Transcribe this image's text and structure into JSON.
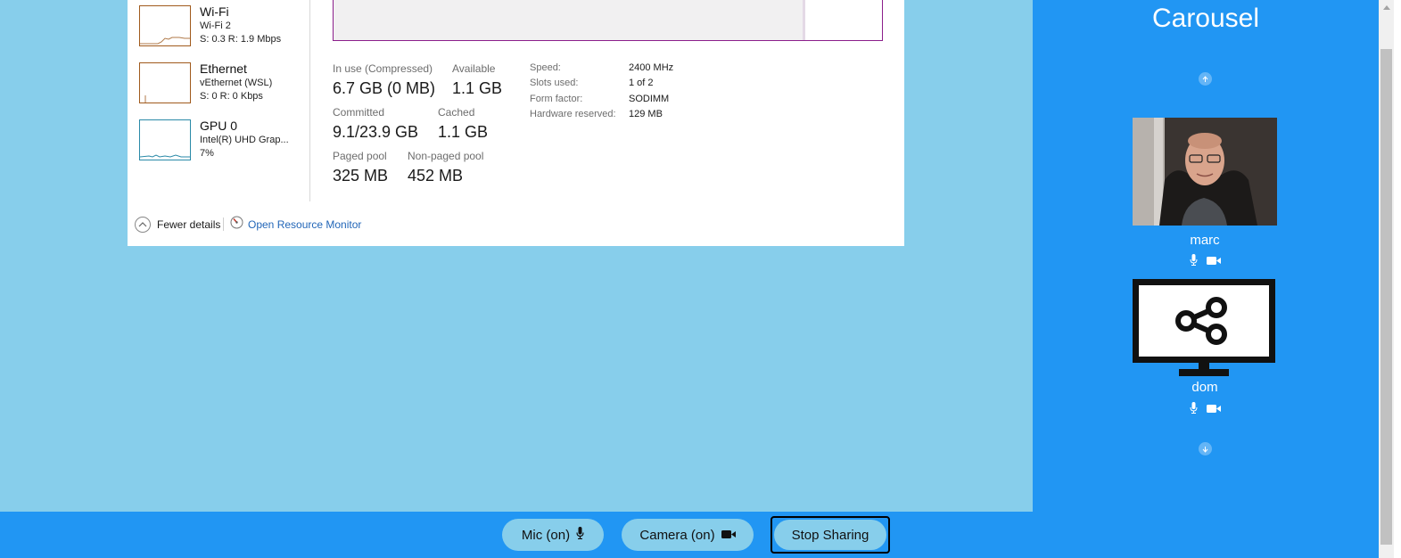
{
  "task_manager": {
    "sidebar": [
      {
        "title": "Wi-Fi",
        "line1": "Wi-Fi 2",
        "line2": "S: 0.3  R: 1.9 Mbps",
        "color": "#a05a1c"
      },
      {
        "title": "Ethernet",
        "line1": "vEthernet (WSL)",
        "line2": "S: 0  R: 0 Kbps",
        "color": "#a05a1c"
      },
      {
        "title": "GPU 0",
        "line1": "Intel(R) UHD Grap...",
        "line2": "7%",
        "color": "#2a8aa8"
      }
    ],
    "stats": {
      "in_use_label": "In use (Compressed)",
      "in_use_value": "6.7 GB (0 MB)",
      "available_label": "Available",
      "available_value": "1.1 GB",
      "committed_label": "Committed",
      "committed_value": "9.1/23.9 GB",
      "cached_label": "Cached",
      "cached_value": "1.1 GB",
      "paged_label": "Paged pool",
      "paged_value": "325 MB",
      "nonpaged_label": "Non-paged pool",
      "nonpaged_value": "452 MB"
    },
    "specs": [
      {
        "label": "Speed:",
        "value": "2400 MHz"
      },
      {
        "label": "Slots used:",
        "value": "1 of 2"
      },
      {
        "label": "Form factor:",
        "value": "SODIMM"
      },
      {
        "label": "Hardware reserved:",
        "value": "129 MB"
      }
    ],
    "footer": {
      "fewer_details": "Fewer details",
      "open_resource_monitor": "Open Resource Monitor"
    },
    "graph_border_color": "#8b1e8b"
  },
  "carousel": {
    "title": "Carousel",
    "participants": [
      {
        "name": "marc",
        "icons": [
          "microphone-icon",
          "video-camera-icon"
        ]
      },
      {
        "name": "dom",
        "icons": [
          "microphone-icon",
          "video-camera-icon"
        ]
      }
    ],
    "up_icon": "arrow-up-icon",
    "down_icon": "arrow-down-icon"
  },
  "controls": {
    "mic_label": "Mic (on)",
    "camera_label": "Camera (on)",
    "stop_sharing_label": "Stop Sharing"
  },
  "colors": {
    "accent": "#2196f3",
    "shared_background": "#87ceeb",
    "pill": "#87ceeb"
  }
}
